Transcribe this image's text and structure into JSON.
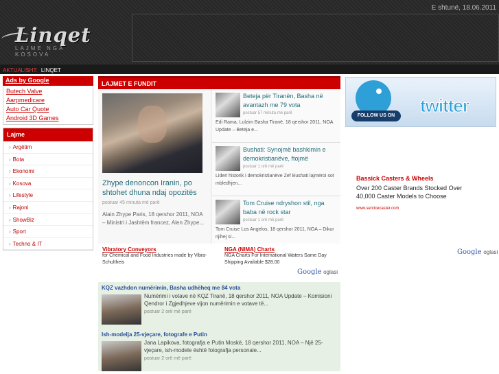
{
  "header": {
    "date": "E shtunë, 18.06.2011",
    "logo_text": "Linqet",
    "logo_tagline": "LAJME NGA KOSOVA"
  },
  "ticker": {
    "label": "AKTUALISHT:",
    "text": "LINQET"
  },
  "left": {
    "ads_by": "Ads by Google",
    "ad_links": [
      "Butech Valve",
      "Aarpmedicare",
      "Auto Car Quote",
      "Android 3D Games"
    ],
    "categories_title": "Lajme",
    "categories": [
      "Argëtim",
      "Bota",
      "Ekonomi",
      "Kosova",
      "Lifestyle",
      "Rajoni",
      "ShowBiz",
      "Sport",
      "Techno & IT"
    ]
  },
  "middle": {
    "latest_title": "LAJMET E FUNDIT",
    "featured": {
      "title": "Zhype denoncon Iranin, po shtohet dhuna ndaj opozitës",
      "time": "postuar 45 minuta më parë",
      "excerpt": "Alain Zhype Paris, 18 qershor 2011, NOA – Ministri i Jashtëm francez, Alen Zhype..."
    },
    "side_news": [
      {
        "title": "Beteja për Tiranën, Basha në avantazh me 79 vota",
        "time": "postuar 57 minuta më parë",
        "excerpt": "Edi Rama, Lulzim Basha Tiranë, 18 qershor 2011, NOA Update – Beteja e..."
      },
      {
        "title": "Bushati: Synojmë bashkimin e demokristianëve, ftojmë",
        "time": "postuar 1 orë më parë",
        "excerpt": "Lideri historik i demokristianëve Zef Bushati lajmëroi sot mbledhjen..."
      },
      {
        "title": "Tom Cruise ndryshon stil, nga baba në rock star",
        "time": "postuar 1 orë më parë",
        "excerpt": "Tom Cruise Los Angelos, 18 qershor 2011, NOA – Dikur njihej si..."
      }
    ],
    "google_ads": [
      {
        "title": "Vibratory Conveyors",
        "desc": "for Chemical and Food Industries made by Vibra-Schultheis"
      },
      {
        "title": "NGA (NIMA) Charts",
        "desc": "NGA Charts For International Waters Same Day Shipping Available $28.00"
      }
    ],
    "google_label": "Google",
    "google_suffix": "oglasi",
    "more_news": [
      {
        "title": "KQZ vazhdon numërimin, Basha udhëheq me 84 vota",
        "excerpt": "Numërimi i votave në KQZ Tiranë, 18 qershor 2011, NOA Update – Komisioni Qendror i Zgjedhjeve vijon numërimin e votave të...",
        "time": "postuar 2 orë më parë"
      },
      {
        "title": "Ish-modelja 25-vjeçare, fotografe e Putin",
        "excerpt": "Jana Lapikova, fotografja e Putin Moskë, 18 qershor 2011, NOA – Një 25-vjeçare, ish-modele është fotografja personale...",
        "time": "postuar 2 orë më parë"
      }
    ]
  },
  "right": {
    "twitter_follow": "FOLLOW US ON",
    "twitter_word": "twitter",
    "ad": {
      "title": "Bassick Casters & Wheels",
      "desc": "Over 200 Caster Brands Stocked Over 40,000 Caster Models to Choose",
      "url": "www.servicecaster.com"
    },
    "google_label": "Google",
    "google_suffix": "oglasi"
  }
}
